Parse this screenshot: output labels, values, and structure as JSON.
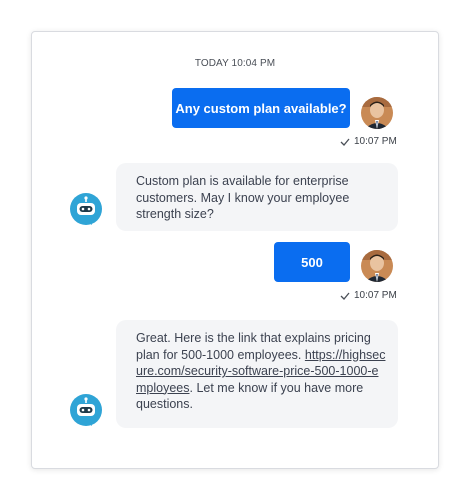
{
  "timestamp": "TODAY 10:04 PM",
  "messages": [
    {
      "from": "user",
      "text": "Any custom plan available?",
      "time": "10:07 PM"
    },
    {
      "from": "bot",
      "text": "Custom plan is available for enterprise customers. May I know your employee strength size?"
    },
    {
      "from": "user",
      "text": "500",
      "time": "10:07 PM"
    },
    {
      "from": "bot",
      "text_before": "Great. Here is the link that explains pricing plan for 500-1000 employees.",
      "link": "https://highsecure.com/security-software-price-500-1000-employees",
      "text_after": ". Let me know if you have more questions."
    }
  ],
  "colors": {
    "user_bubble": "#0a6df0",
    "bot_bubble": "#f4f5f7",
    "bot_icon": "#2fa4d6"
  },
  "icons": {
    "sent": "check-icon",
    "user_avatar": "avatar",
    "bot_avatar": "chatbot-icon"
  }
}
